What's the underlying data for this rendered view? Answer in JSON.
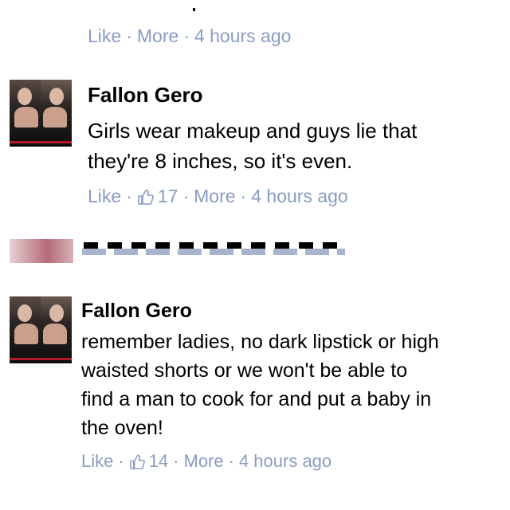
{
  "top_comment": {
    "meta": {
      "like_label": "Like",
      "separator": "·",
      "more_label": "More",
      "time": "4 hours ago"
    }
  },
  "comments": [
    {
      "author": "Fallon Gero",
      "text_lines": [
        "Girls wear makeup and guys lie that",
        "they're 8 inches, so it's even."
      ],
      "meta": {
        "like_label": "Like",
        "separator": "·",
        "like_count": "17",
        "more_label": "More",
        "time": "4 hours ago"
      }
    },
    {
      "author": "Fallon Gero",
      "text_lines": [
        "remember ladies, no dark lipstick or high",
        "waisted shorts or we won't be able to",
        "find a man to cook for and put a baby in",
        "the oven!"
      ],
      "meta": {
        "like_label": "Like",
        "separator": "·",
        "like_count": "14",
        "more_label": "More",
        "time": "4 hours ago"
      }
    }
  ],
  "colors": {
    "meta_text": "#8b9cc2",
    "body_text": "#000000",
    "background": "#ffffff"
  },
  "icons": {
    "like_count_icon": "thumbs-up-icon"
  }
}
